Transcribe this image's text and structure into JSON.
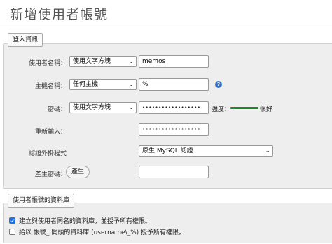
{
  "page": {
    "title": "新增使用者帳號"
  },
  "login": {
    "legend": "登入資訊",
    "username_label": "使用者名稱：",
    "username_type": "使用文字方塊",
    "username_value": "memos",
    "host_label": "主機名稱：",
    "host_type": "任何主機",
    "host_value": "%",
    "password_label": "密碼：",
    "password_type": "使用文字方塊",
    "password_value": "••••••••••••••••••",
    "strength_label": "強度：",
    "strength_value": "很好",
    "retype_label": "重新輸入：",
    "retype_value": "••••••••••••••••••",
    "auth_label": "認證外掛程式",
    "auth_value": "原生 MySQL 認證",
    "generate_label": "產生密碼：",
    "generate_button": "產生",
    "generated_value": ""
  },
  "db": {
    "legend": "使用者帳號的資料庫",
    "option1": "建立與使用者同名的資料庫，並授予所有權限。",
    "option1_checked": true,
    "option2": "給以 帳號_ 開頭的資料庫 (username\\_%) 授予所有權限。",
    "option2_checked": false
  },
  "colors": {
    "accent": "#1a73e8",
    "strength": "#1a8a2a",
    "help": "#3b73c4"
  }
}
